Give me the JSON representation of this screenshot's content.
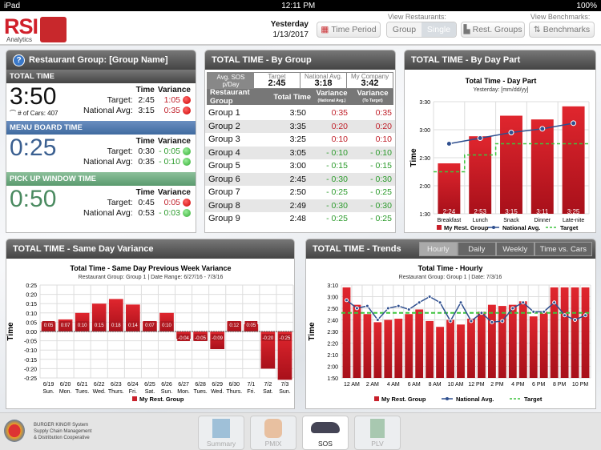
{
  "status": {
    "device": "iPad",
    "time": "12:11 PM",
    "battery": "100%"
  },
  "header": {
    "logo": "RSI",
    "logo_sub": "Analytics",
    "period_label": "Yesterday",
    "date": "1/13/2017",
    "time_period": "Time Period",
    "view_restaurants": "View Restaurants:",
    "group": "Group",
    "single": "Single",
    "rest_groups": "Rest. Groups",
    "view_benchmarks": "View Benchmarks:",
    "benchmarks": "Benchmarks"
  },
  "summary": {
    "title": "Restaurant Group: [Group Name]",
    "col_time": "Time",
    "col_variance": "Variance",
    "target_label": "Target:",
    "natl_label": "National Avg:",
    "sections": [
      {
        "name": "TOTAL TIME",
        "value": "3:50",
        "cars": "# of Cars: 407",
        "target": "2:45",
        "target_var": "1:05",
        "target_status": "red",
        "natl": "3:15",
        "natl_var": "0:35",
        "natl_status": "red"
      },
      {
        "name": "MENU BOARD TIME",
        "value": "0:25",
        "target": "0:30",
        "target_var": "- 0:05",
        "target_status": "green",
        "natl": "0:35",
        "natl_var": "- 0:10",
        "natl_status": "green"
      },
      {
        "name": "PICK UP WINDOW TIME",
        "value": "0:50",
        "target": "0:45",
        "target_var": "0:05",
        "target_status": "red",
        "natl": "0:53",
        "natl_var": "- 0:03",
        "natl_status": "green"
      }
    ]
  },
  "by_group": {
    "title": "TOTAL TIME - By Group",
    "avg_label": "Avg. SOS p/Day",
    "target_label": "Target",
    "target": "2:45",
    "natl_label": "National Avg.",
    "natl": "3:18",
    "company_label": "My Company",
    "company": "3:42",
    "headers": [
      "Restaurant Group",
      "Total Time",
      "Variance",
      "(National Avg.)",
      "Variance",
      "(To Target)"
    ],
    "rows": [
      [
        "Group 1",
        "3:50",
        "0:35",
        "0:35"
      ],
      [
        "Group 2",
        "3:35",
        "0:20",
        "0:20"
      ],
      [
        "Group 3",
        "3:25",
        "0:10",
        "0:10"
      ],
      [
        "Group 4",
        "3:05",
        "- 0:10",
        "- 0:10"
      ],
      [
        "Group 5",
        "3:00",
        "- 0:15",
        "- 0:15"
      ],
      [
        "Group 6",
        "2:45",
        "- 0:30",
        "- 0:30"
      ],
      [
        "Group 7",
        "2:50",
        "- 0:25",
        "- 0:25"
      ],
      [
        "Group 8",
        "2:49",
        "- 0:30",
        "- 0:30"
      ],
      [
        "Group 9",
        "2:48",
        "- 0:25",
        "- 0:25"
      ]
    ]
  },
  "colors": {
    "bar": "#c8202a",
    "line": "#2f4f8f",
    "target": "#3ec43e",
    "red": "#c0202a",
    "green": "#2a9a2a"
  },
  "panels": {
    "daypart": "TOTAL TIME - By Day Part",
    "variance": "TOTAL TIME - Same Day Variance",
    "trends": "TOTAL TIME - Trends",
    "trend_tabs": [
      "Hourly",
      "Daily",
      "Weekly",
      "Time vs. Cars"
    ]
  },
  "chart_data": [
    {
      "type": "bar",
      "title": "Total Time - Day Part",
      "subtitle": "Yesterday: [mm/dd/yy]",
      "ylabel": "Time",
      "ylim": [
        90,
        210
      ],
      "yticks": [
        90,
        120,
        150,
        180,
        210
      ],
      "ytick_labels": [
        "1:30",
        "2:00",
        "2:30",
        "3:00",
        "3:30"
      ],
      "categories": [
        "Breakfast",
        "Lunch",
        "Snack",
        "Dinner",
        "Late-nite"
      ],
      "values": [
        144,
        173,
        195,
        191,
        205
      ],
      "labels": [
        "2:24",
        "2:53",
        "3:15",
        "3:11",
        "3:25"
      ],
      "national": [
        165,
        171,
        177,
        181,
        187
      ],
      "target": [
        135,
        153,
        165,
        165,
        165
      ],
      "legend": [
        "My Rest. Group",
        "National Avg.",
        "Target"
      ]
    },
    {
      "type": "bar",
      "title": "Total Time - Same Day Previous Week Variance",
      "subtitle": "Restaurant Group: Group 1  |  Date Range: 6/27/16 - 7/3/16",
      "ylabel": "Time",
      "ylim": [
        -25,
        25
      ],
      "yticks": [
        25,
        20,
        15,
        10,
        5,
        0,
        -5,
        -10,
        -15,
        -20,
        -25
      ],
      "ytick_labels": [
        "0:25",
        "0:20",
        "0:15",
        "0:10",
        "0:05",
        "0:00",
        "-0:05",
        "-0:10",
        "-0:15",
        "-0:20",
        "-0:25"
      ],
      "categories": [
        "6/19",
        "6/20",
        "6/21",
        "6/22",
        "6/23",
        "6/24",
        "6/25",
        "6/26",
        "6/27",
        "6/28",
        "6/29",
        "6/30",
        "7/1",
        "7/2",
        "7/3"
      ],
      "days": [
        "Sun.",
        "Mon.",
        "Tues.",
        "Wed.",
        "Thurs.",
        "Fri.",
        "Sat.",
        "Sun.",
        "Mon.",
        "Tues.",
        "Wed.",
        "Thurs.",
        "Fri.",
        "Sat.",
        "Sun."
      ],
      "values": [
        5,
        6.5,
        10,
        15,
        17.5,
        14.5,
        5.5,
        10,
        -4,
        -5,
        -9.5,
        5.5,
        4,
        -20,
        -26
      ],
      "labels": [
        "0:05",
        "0:07",
        "0:10",
        "0:15",
        "0:18",
        "0:14",
        "0:07",
        "0:10",
        "-0:04",
        "-0:05",
        "-0:09",
        "0:12",
        "0:05",
        "-0:20",
        "-0:25"
      ],
      "legend": [
        "My Rest. Group"
      ]
    },
    {
      "type": "bar",
      "title": "Total Time - Hourly",
      "subtitle": "Restaurant Group: Group 1  |  Date: 7/3/16",
      "ylabel": "Time",
      "ylim": [
        110,
        190
      ],
      "yticks": [
        110,
        120,
        130,
        140,
        150,
        160,
        170,
        180,
        190
      ],
      "ytick_labels": [
        "1:50",
        "2:00",
        "2:10",
        "2:20",
        "2:30",
        "2:40",
        "2:50",
        "3:00",
        "3:10"
      ],
      "categories": [
        "12 AM",
        "",
        "2 AM",
        "",
        "4 AM",
        "",
        "6 AM",
        "",
        "8 AM",
        "",
        "10 AM",
        "",
        "12 PM",
        "",
        "2 PM",
        "",
        "4 PM",
        "",
        "6 PM",
        "",
        "8 PM",
        "",
        "10 PM",
        ""
      ],
      "values": [
        188,
        173,
        165,
        158,
        160,
        161,
        165,
        169,
        159,
        154,
        160,
        156,
        161,
        167,
        173,
        172,
        173,
        176,
        163,
        167,
        188,
        188,
        188,
        188
      ],
      "national": [
        177,
        170,
        172,
        160,
        170,
        172,
        169,
        175,
        180,
        175,
        159,
        175,
        159,
        166,
        158,
        159,
        170,
        175,
        167,
        167,
        175,
        164,
        160,
        164
      ],
      "target": 166,
      "legend": [
        "My Rest. Group",
        "National Avg.",
        "Target"
      ]
    }
  ],
  "footer": {
    "brand_line1": "BURGER KING® System",
    "brand_line2": "Supply Chain Management",
    "brand_line3": "& Distribution Cooperative",
    "tabs": [
      "Summary",
      "PMIX",
      "SOS",
      "PLV"
    ]
  }
}
